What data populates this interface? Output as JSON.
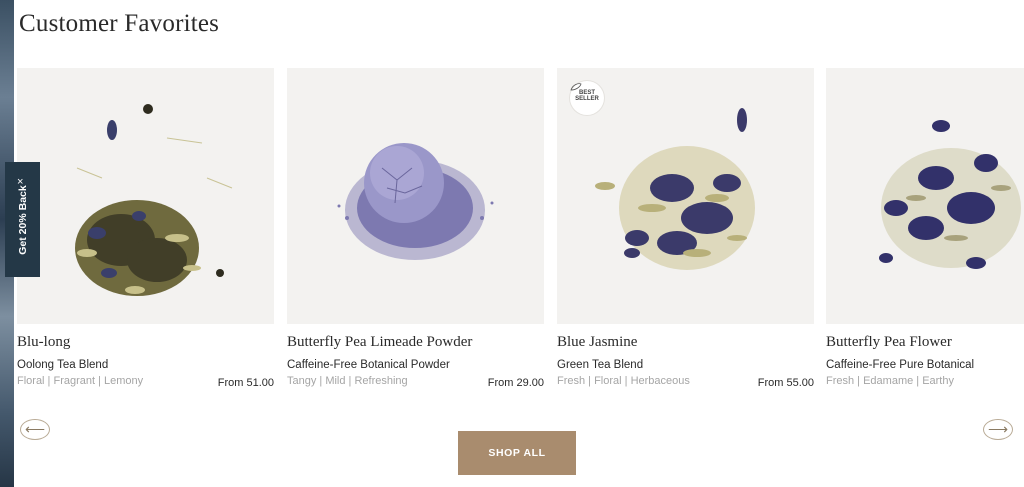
{
  "section": {
    "title": "Customer Favorites"
  },
  "promo": {
    "label": "Get 20% Back",
    "close_symbol": "×"
  },
  "products": [
    {
      "name": "Blu-long",
      "type": "Oolong Tea Blend",
      "notes": "Floral | Fragrant | Lemony",
      "price": "From 51.00",
      "badge": null
    },
    {
      "name": "Butterfly Pea Limeade Powder",
      "type": "Caffeine-Free Botanical Powder",
      "notes": "Tangy | Mild | Refreshing",
      "price": "From 29.00",
      "badge": null
    },
    {
      "name": "Blue Jasmine",
      "type": "Green Tea Blend",
      "notes": "Fresh | Floral | Herbaceous",
      "price": "From 55.00",
      "badge": {
        "line1": "BEST",
        "line2": "SELLER"
      }
    },
    {
      "name": "Butterfly Pea Flower",
      "type": "Caffeine-Free Pure Botanical",
      "notes": "Fresh | Edamame | Earthy",
      "price": "",
      "badge": null
    }
  ],
  "nav": {
    "prev_icon": "arrow-left-icon",
    "next_icon": "arrow-right-icon",
    "prev_symbol": "⟵",
    "next_symbol": "⟶"
  },
  "cta": {
    "shop_all_label": "SHOP ALL"
  },
  "colors": {
    "accent": "#a98c6e",
    "promo_bg": "#243847",
    "card_bg": "#f3f2f0",
    "muted_text": "#a5a5a5"
  }
}
